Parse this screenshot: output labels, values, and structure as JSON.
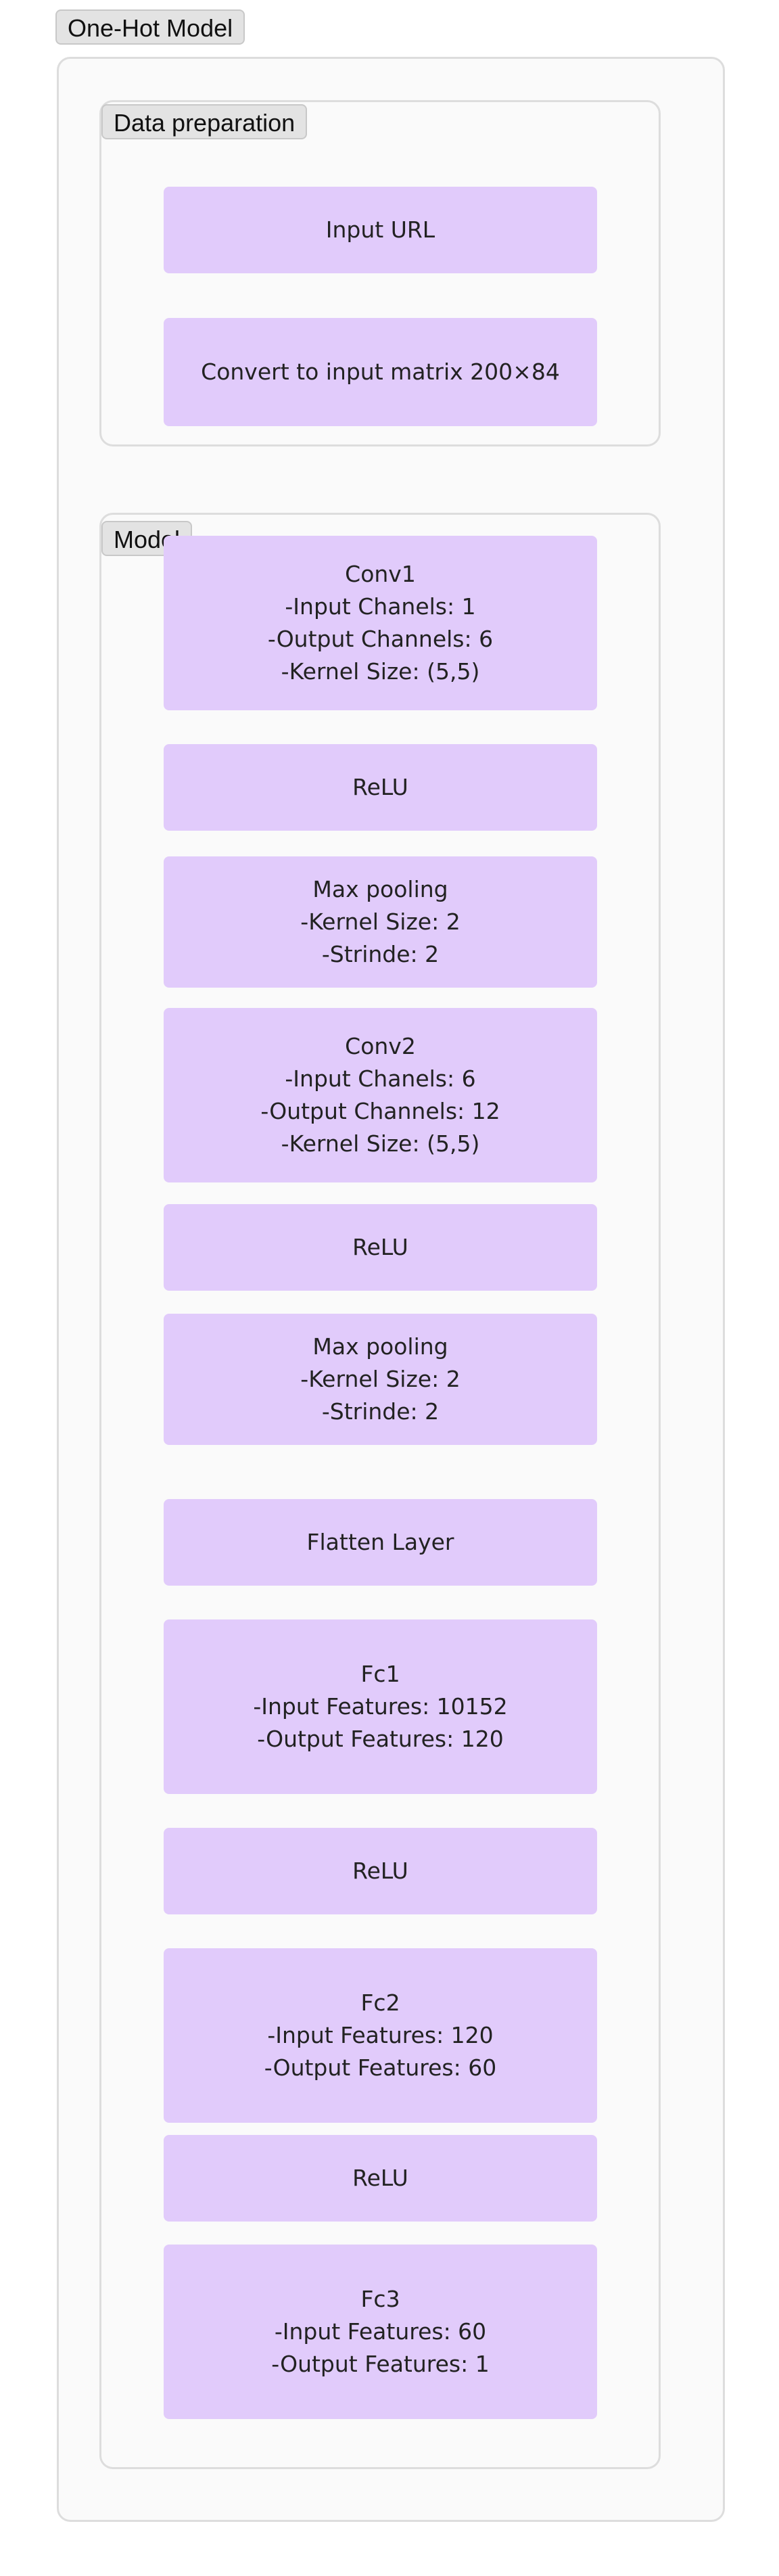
{
  "outer_group": {
    "label": "One-Hot Model"
  },
  "prep_group": {
    "label": "Data preparation",
    "nodes": [
      {
        "lines": [
          "Input URL"
        ]
      },
      {
        "lines": [
          "Convert to input matrix 200×84"
        ]
      }
    ]
  },
  "model_group": {
    "label": "Model",
    "nodes": [
      {
        "lines": [
          "Conv1",
          "-Input Chanels: 1",
          "-Output Channels: 6",
          "-Kernel Size: (5,5)"
        ]
      },
      {
        "lines": [
          "ReLU"
        ]
      },
      {
        "lines": [
          "Max pooling",
          "-Kernel Size: 2",
          "-Strinde: 2"
        ]
      },
      {
        "lines": [
          "Conv2",
          "-Input Chanels: 6",
          "-Output Channels: 12",
          "-Kernel Size: (5,5)"
        ]
      },
      {
        "lines": [
          "ReLU"
        ]
      },
      {
        "lines": [
          "Max pooling",
          "-Kernel Size: 2",
          "-Strinde: 2"
        ]
      },
      {
        "lines": [
          "Flatten Layer"
        ]
      },
      {
        "lines": [
          "Fc1",
          "-Input Features: 10152",
          "-Output Features: 120"
        ]
      },
      {
        "lines": [
          "ReLU"
        ]
      },
      {
        "lines": [
          "Fc2",
          "-Input Features: 120",
          "-Output Features: 60"
        ]
      },
      {
        "lines": [
          "ReLU"
        ]
      },
      {
        "lines": [
          "Fc3",
          "-Input Features: 60",
          "-Output Features: 1"
        ]
      }
    ]
  },
  "colors": {
    "node_fill": "#e1cbfb",
    "frame_fill": "#fafafa",
    "frame_border": "#dddddd",
    "label_fill": "#e3e3e3"
  }
}
